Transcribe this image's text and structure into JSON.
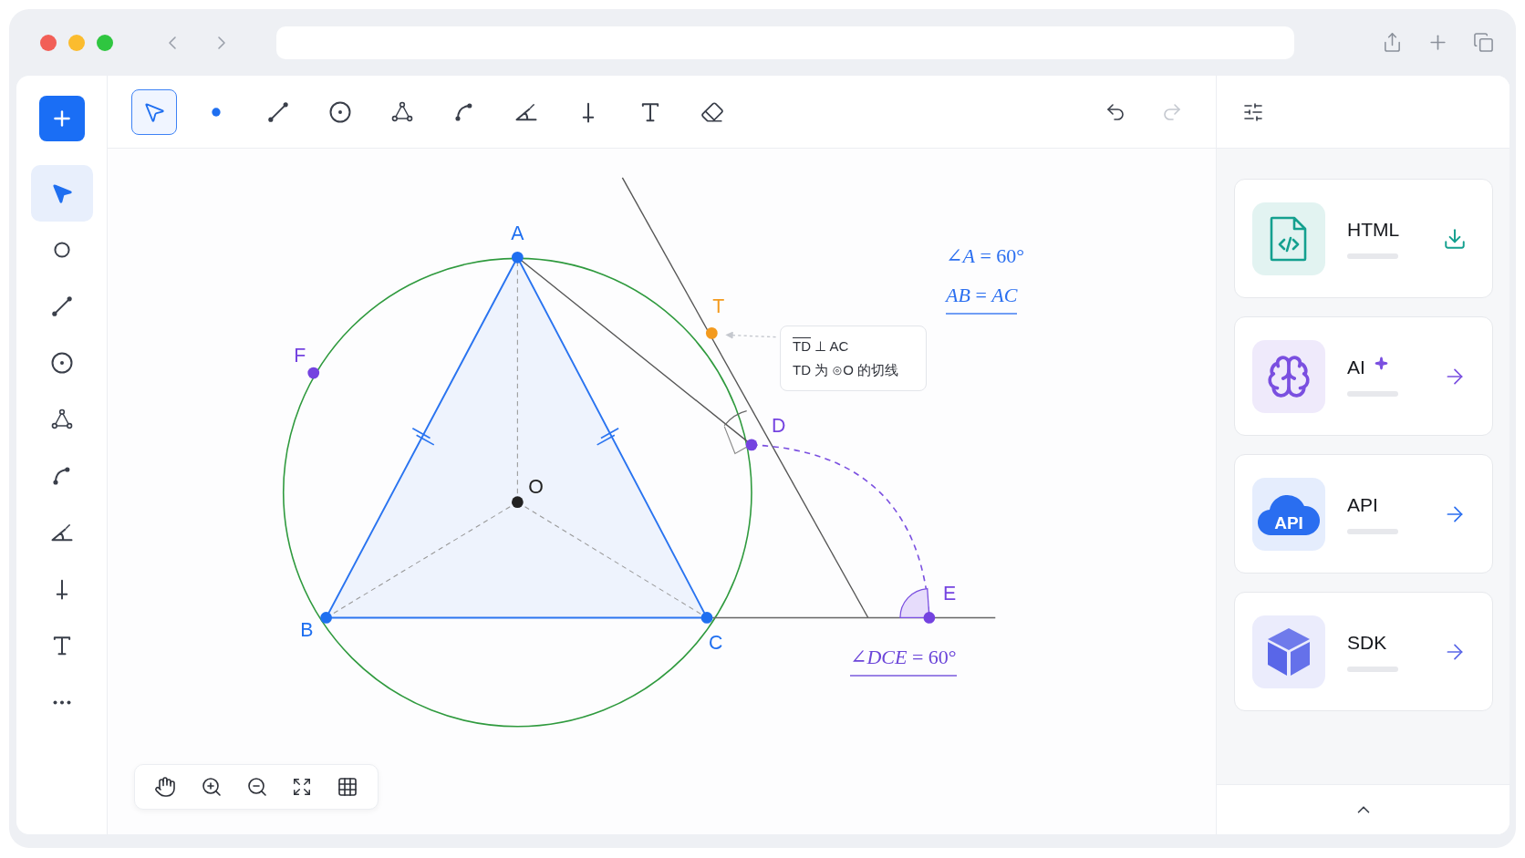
{
  "toolbar": {
    "tools": [
      {
        "kind": "select",
        "selected": true
      },
      {
        "kind": "point",
        "selected": false
      },
      {
        "kind": "segment",
        "selected": false
      },
      {
        "kind": "circle",
        "selected": false
      },
      {
        "kind": "polygon",
        "selected": false
      },
      {
        "kind": "arc",
        "selected": false
      },
      {
        "kind": "angle",
        "selected": false
      },
      {
        "kind": "perpendicular",
        "selected": false
      },
      {
        "kind": "text",
        "selected": false
      },
      {
        "kind": "eraser",
        "selected": false
      }
    ],
    "undo": {
      "disabled": false
    },
    "redo": {
      "disabled": true
    }
  },
  "sidebar": {
    "tools": [
      {
        "kind": "select",
        "selected": true
      },
      {
        "kind": "ring",
        "selected": false
      },
      {
        "kind": "segment",
        "selected": false
      },
      {
        "kind": "circle",
        "selected": false
      },
      {
        "kind": "polygon",
        "selected": false
      },
      {
        "kind": "arc",
        "selected": false
      },
      {
        "kind": "angle",
        "selected": false
      },
      {
        "kind": "perpendicular",
        "selected": false
      },
      {
        "kind": "text",
        "selected": false
      },
      {
        "kind": "more",
        "selected": false
      }
    ]
  },
  "canvas": {
    "points": [
      {
        "label": "A",
        "color": "#1f6ff0"
      },
      {
        "label": "B",
        "color": "#1f6ff0"
      },
      {
        "label": "C",
        "color": "#1f6ff0"
      },
      {
        "label": "O",
        "color": "#222222"
      },
      {
        "label": "T",
        "color": "#f39a1e"
      },
      {
        "label": "D",
        "color": "#7443e0"
      },
      {
        "label": "E",
        "color": "#7443e0"
      },
      {
        "label": "F",
        "color": "#7443e0"
      }
    ],
    "note": {
      "segment": "TD",
      "relation": "⊥ AC",
      "line_2": "TD 为 ⊙O 的切线"
    },
    "formulas": [
      {
        "text": "∠*A* = 60°",
        "color": "#2b6ff0",
        "underlined": false
      },
      {
        "text": "*AB* = *AC*",
        "color": "#2b6ff0",
        "underlined": true
      },
      {
        "text": "∠*DCE* = 60°",
        "color": "#6b45d9",
        "underlined": true
      }
    ]
  },
  "panel": {
    "cards": [
      {
        "kind": "html",
        "title": "HTML",
        "color": "#14a08f",
        "action": {
          "kind": "download"
        },
        "sparkle": false
      },
      {
        "kind": "ai",
        "title": "AI",
        "color": "#7a4fe0",
        "action": {
          "kind": "open"
        },
        "sparkle": true
      },
      {
        "kind": "api",
        "title": "API",
        "color": "#2a6ef0",
        "action": {
          "kind": "open"
        },
        "sparkle": false,
        "icon_text": "API"
      },
      {
        "kind": "sdk",
        "title": "SDK",
        "color": "#5966e8",
        "action": {
          "kind": "open"
        },
        "sparkle": false
      }
    ]
  }
}
